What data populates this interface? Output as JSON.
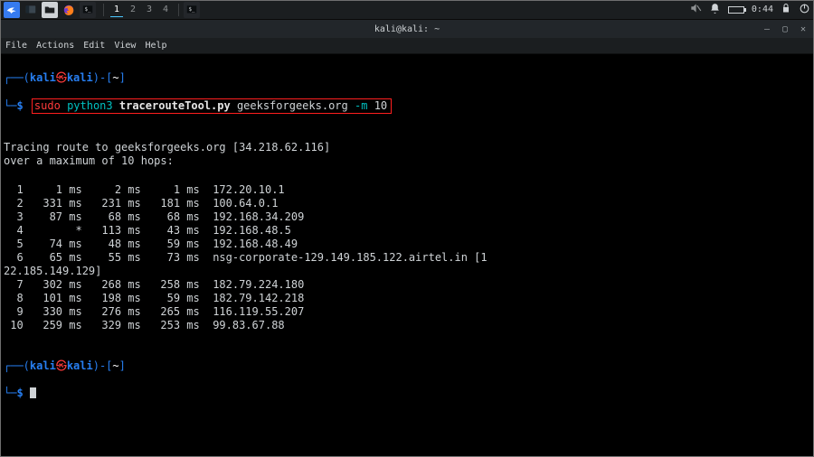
{
  "taskbar": {
    "workspaces": [
      "1",
      "2",
      "3",
      "4"
    ],
    "active_ws": 0,
    "clock": "0:44"
  },
  "window": {
    "title": "kali@kali: ~"
  },
  "menubar": [
    "File",
    "Actions",
    "Edit",
    "View",
    "Help"
  ],
  "prompt": {
    "open1": "┌──(",
    "user": "kali",
    "at": "㉿",
    "host": "kali",
    "close1": ")-[",
    "path": "~",
    "close2": "]",
    "line2_prefix": "└─",
    "dollar": "$"
  },
  "command": {
    "sudo": "sudo",
    "interp": "python3",
    "script": "tracerouteTool.py",
    "target": "geeksforgeeks.org",
    "flag": "-m",
    "flag_arg": "10"
  },
  "trace": {
    "header1": "Tracing route to geeksforgeeks.org [34.218.62.116]",
    "header2": "over a maximum of 10 hops:",
    "hops": [
      {
        "n": "1",
        "a": "1 ms",
        "b": "2 ms",
        "c": "1 ms",
        "addr": "172.20.10.1"
      },
      {
        "n": "2",
        "a": "331 ms",
        "b": "231 ms",
        "c": "181 ms",
        "addr": "100.64.0.1"
      },
      {
        "n": "3",
        "a": "87 ms",
        "b": "68 ms",
        "c": "68 ms",
        "addr": "192.168.34.209"
      },
      {
        "n": "4",
        "a": "*",
        "b": "113 ms",
        "c": "43 ms",
        "addr": "192.168.48.5"
      },
      {
        "n": "5",
        "a": "74 ms",
        "b": "48 ms",
        "c": "59 ms",
        "addr": "192.168.48.49"
      },
      {
        "n": "6",
        "a": "65 ms",
        "b": "55 ms",
        "c": "73 ms",
        "addr": "nsg-corporate-129.149.185.122.airtel.in [122.185.149.129]",
        "wrap": true
      },
      {
        "n": "7",
        "a": "302 ms",
        "b": "268 ms",
        "c": "258 ms",
        "addr": "182.79.224.180"
      },
      {
        "n": "8",
        "a": "101 ms",
        "b": "198 ms",
        "c": "59 ms",
        "addr": "182.79.142.218"
      },
      {
        "n": "9",
        "a": "330 ms",
        "b": "276 ms",
        "c": "265 ms",
        "addr": "116.119.55.207"
      },
      {
        "n": "10",
        "a": "259 ms",
        "b": "329 ms",
        "c": "253 ms",
        "addr": "99.83.67.88"
      }
    ]
  }
}
